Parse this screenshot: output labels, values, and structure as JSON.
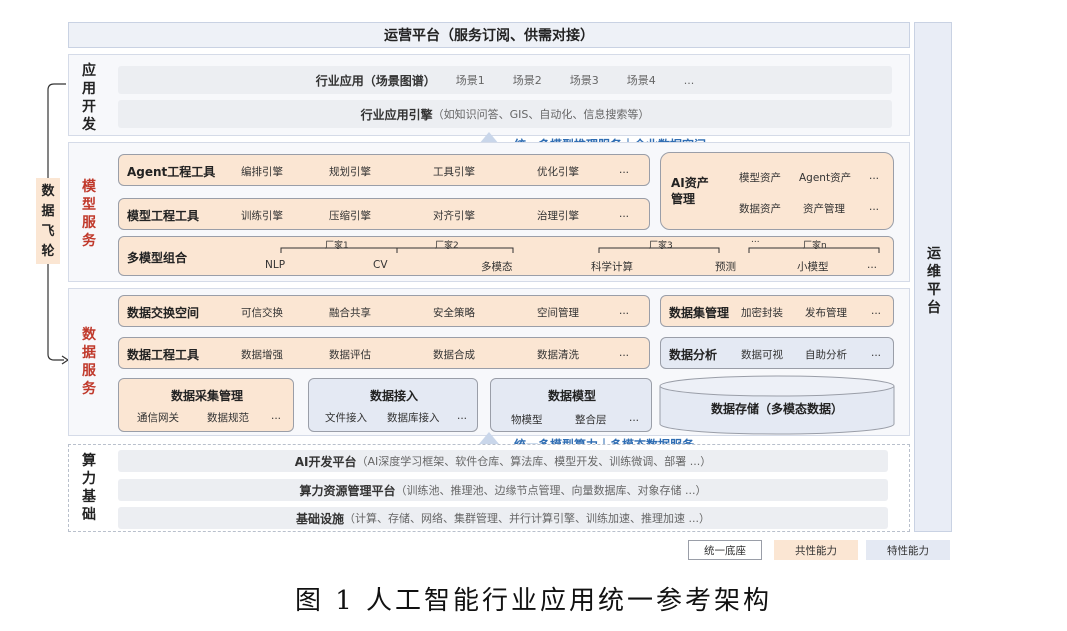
{
  "top_bar": "运营平台（服务订阅、供需对接）",
  "ops_platform": [
    "运",
    "维",
    "平",
    "台"
  ],
  "flywheel": [
    "数",
    "据",
    "飞",
    "轮"
  ],
  "app_dev": {
    "label": [
      "应",
      "用",
      "开",
      "发"
    ],
    "row1": {
      "title": "行业应用（场景图谱）",
      "items": [
        "场景1",
        "场景2",
        "场景3",
        "场景4",
        "..."
      ]
    },
    "row2": {
      "title": "行业应用引擎",
      "desc": "（如知识问答、GIS、自动化、信息搜索等）"
    }
  },
  "banner_top": "统一多模型推理服务｜企业数据空间",
  "model_service": {
    "label": [
      "模",
      "型",
      "服",
      "务"
    ],
    "agent": {
      "title": "Agent工程工具",
      "items": [
        "编排引擎",
        "规划引擎",
        "工具引擎",
        "优化引擎",
        "..."
      ]
    },
    "model": {
      "title": "模型工程工具",
      "items": [
        "训练引擎",
        "压缩引擎",
        "对齐引擎",
        "治理引擎",
        "..."
      ]
    },
    "ai_asset": {
      "title": [
        "AI资产",
        "管理"
      ],
      "items": [
        "模型资产",
        "Agent资产",
        "...",
        "数据资产",
        "资产管理",
        "..."
      ]
    },
    "multi": {
      "title": "多模型组合",
      "vendors": [
        "厂家1",
        "厂家2",
        "厂家3",
        "...",
        "厂家n"
      ],
      "items": [
        "NLP",
        "CV",
        "多模态",
        "科学计算",
        "预测",
        "小模型",
        "..."
      ]
    }
  },
  "data_service": {
    "label": [
      "数",
      "据",
      "服",
      "务"
    ],
    "exchange": {
      "title": "数据交换空间",
      "items": [
        "可信交换",
        "融合共享",
        "安全策略",
        "空间管理",
        "..."
      ]
    },
    "dataset": {
      "title": "数据集管理",
      "items": [
        "加密封装",
        "发布管理",
        "..."
      ]
    },
    "engineering": {
      "title": "数据工程工具",
      "items": [
        "数据增强",
        "数据评估",
        "数据合成",
        "数据清洗",
        "..."
      ]
    },
    "analysis": {
      "title": "数据分析",
      "items": [
        "数据可视",
        "自助分析",
        "..."
      ]
    },
    "collect": {
      "title": "数据采集管理",
      "items": [
        "通信网关",
        "数据规范",
        "..."
      ]
    },
    "access": {
      "title": "数据接入",
      "items": [
        "文件接入",
        "数据库接入",
        "..."
      ]
    },
    "dmodel": {
      "title": "数据模型",
      "items": [
        "物模型",
        "整合层",
        "..."
      ]
    },
    "storage": "数据存储（多模态数据）"
  },
  "banner_bottom": "统一多模型算力｜多模态数据服务",
  "compute": {
    "label": [
      "算",
      "力",
      "基",
      "础"
    ],
    "rows": [
      {
        "title": "AI开发平台",
        "desc": "（AI深度学习框架、软件仓库、算法库、模型开发、训练微调、部署 ...）"
      },
      {
        "title": "算力资源管理平台",
        "desc": "（训练池、推理池、边缘节点管理、向量数据库、对象存储 ...）"
      },
      {
        "title": "基础设施",
        "desc": "（计算、存储、网络、集群管理、并行计算引擎、训练加速、推理加速 ...）"
      }
    ]
  },
  "legend": [
    "统一底座",
    "共性能力",
    "特性能力"
  ],
  "colors": {
    "orange": "#fbe6d3",
    "blue": "#e4e9f3",
    "banner": "#2f6db3",
    "label_red": "#c0392b"
  },
  "caption": "图 1 人工智能行业应用统一参考架构"
}
